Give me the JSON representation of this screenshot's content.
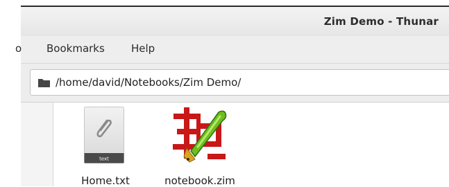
{
  "window": {
    "title": "Zim Demo - Thunar"
  },
  "menubar": {
    "items": [
      "Go",
      "Bookmarks",
      "Help"
    ],
    "go_visible": "o"
  },
  "location": {
    "path": "/home/david/Notebooks/Zim Demo/"
  },
  "files": [
    {
      "name": "Home.txt",
      "badge": "text",
      "icon": "text-file-icon"
    },
    {
      "name": "notebook.zim",
      "icon": "zim-notebook-icon"
    }
  ],
  "colors": {
    "folder": "#444444",
    "zim_red": "#c81818",
    "pen_green": "#6cbf1f",
    "nib_gold": "#d9a51e"
  }
}
